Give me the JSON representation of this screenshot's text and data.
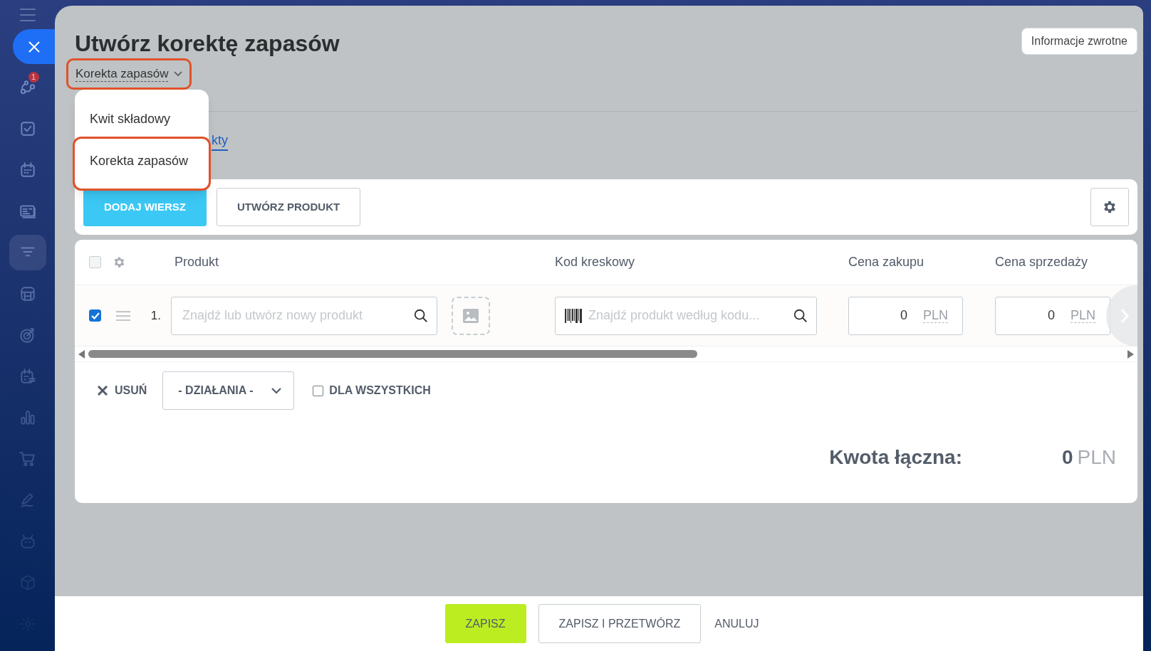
{
  "sidebar": {
    "items": [
      {
        "kind": "flow",
        "badge": "1",
        "selected": false
      },
      {
        "kind": "task",
        "selected": false
      },
      {
        "kind": "calendar",
        "selected": false
      },
      {
        "kind": "contact",
        "selected": false
      },
      {
        "kind": "funnel",
        "selected": true
      },
      {
        "kind": "store",
        "selected": false
      },
      {
        "kind": "target",
        "selected": false
      },
      {
        "kind": "schedule",
        "selected": false
      },
      {
        "kind": "chart",
        "selected": false
      },
      {
        "kind": "cart",
        "selected": false
      },
      {
        "kind": "pen",
        "selected": false
      },
      {
        "kind": "robot",
        "selected": false
      },
      {
        "kind": "box",
        "selected": false
      },
      {
        "kind": "gear",
        "selected": false
      }
    ]
  },
  "title": "Utwórz korektę zapasów",
  "feedback_button": "Informacje zwrotne",
  "type_selector": {
    "value": "Korekta zapasów",
    "expanded": true,
    "highlighted": true
  },
  "type_menu": {
    "options": [
      {
        "label": "Kwit składowy",
        "highlighted": false
      },
      {
        "label": "Korekta zapasów",
        "highlighted": true
      }
    ]
  },
  "tabs": [
    {
      "label": "kty",
      "selected": true
    }
  ],
  "toolbar": {
    "buttons": [
      {
        "label": "DODAJ WIERSZ",
        "kind": "primary"
      },
      {
        "label": "UTWÓRZ PRODUKT",
        "kind": "secondary"
      }
    ]
  },
  "table": {
    "select_all_checked": false,
    "columns": [
      "Produkt",
      "Kod kreskowy",
      "Cena zakupu",
      "Cena sprzedaży"
    ],
    "rows": [
      {
        "checked": true,
        "number": "1.",
        "product_placeholder": "Znajdź lub utwórz nowy produkt",
        "barcode_placeholder": "Znajdź produkt według kodu...",
        "purchase_price": "0",
        "purchase_currency": "PLN",
        "sale_price": "0",
        "sale_currency": "PLN"
      }
    ]
  },
  "actions": {
    "delete": "USUŃ",
    "actions_dropdown": "- DZIAŁANIA -",
    "for_all": {
      "label": "DLA WSZYSTKICH",
      "checked": false
    }
  },
  "total": {
    "label": "Kwota łączna:",
    "value": "0",
    "currency": "PLN"
  },
  "footer": {
    "buttons": [
      {
        "label": "ZAPISZ",
        "kind": "primary"
      },
      {
        "label": "ZAPISZ I PRZETWÓRZ",
        "kind": "secondary"
      },
      {
        "label": "ANULUJ",
        "kind": "link"
      }
    ]
  }
}
